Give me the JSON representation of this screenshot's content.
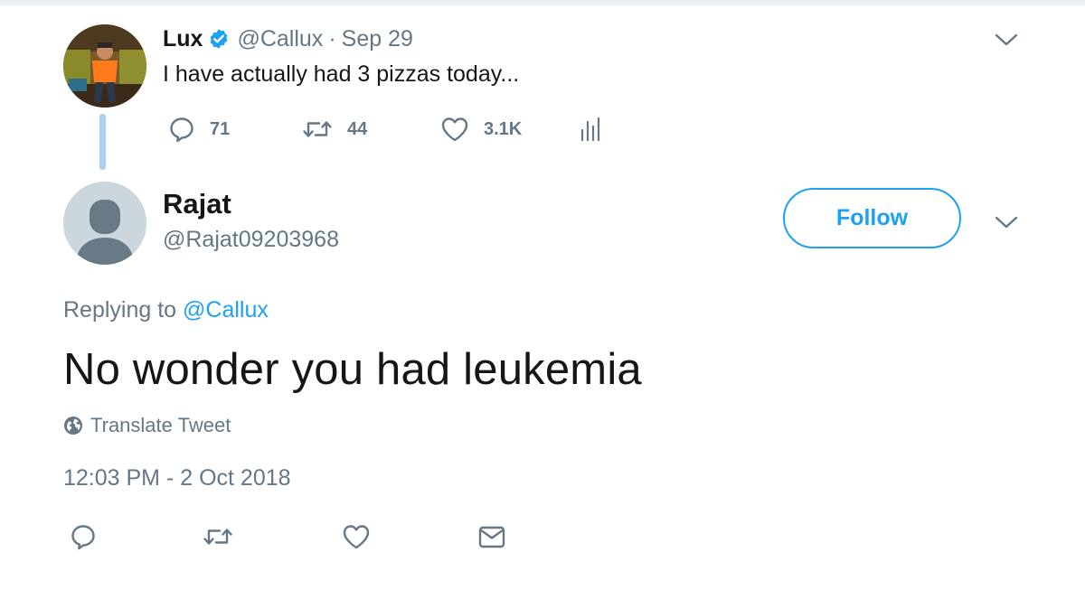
{
  "parent_tweet": {
    "author_name": "Lux",
    "handle": "@Callux",
    "separator": "·",
    "date": "Sep 29",
    "text": "I have actually had 3 pizzas today...",
    "stats": {
      "replies": "71",
      "retweets": "44",
      "likes": "3.1K"
    },
    "icons": [
      "verified-badge-icon",
      "chevron-down-icon",
      "reply-icon",
      "retweet-icon",
      "heart-icon",
      "analytics-icon"
    ]
  },
  "reply_tweet": {
    "author_name": "Rajat",
    "handle": "@Rajat09203968",
    "follow_label": "Follow",
    "replying_prefix": "Replying to ",
    "replying_mention": "@Callux",
    "text": "No wonder you had leukemia",
    "translate_label": "Translate Tweet",
    "timestamp": "12:03 PM - 2 Oct 2018",
    "icons": [
      "chevron-down-icon",
      "globe-icon",
      "reply-icon",
      "retweet-icon",
      "heart-icon",
      "direct-message-icon"
    ]
  },
  "colors": {
    "accent": "#1da1f2",
    "text_primary": "#14171a",
    "text_secondary": "#657786",
    "thread_line": "#a8d2ef",
    "default_avatar_bg": "#ccd6dd",
    "default_avatar_fg": "#687a86"
  }
}
